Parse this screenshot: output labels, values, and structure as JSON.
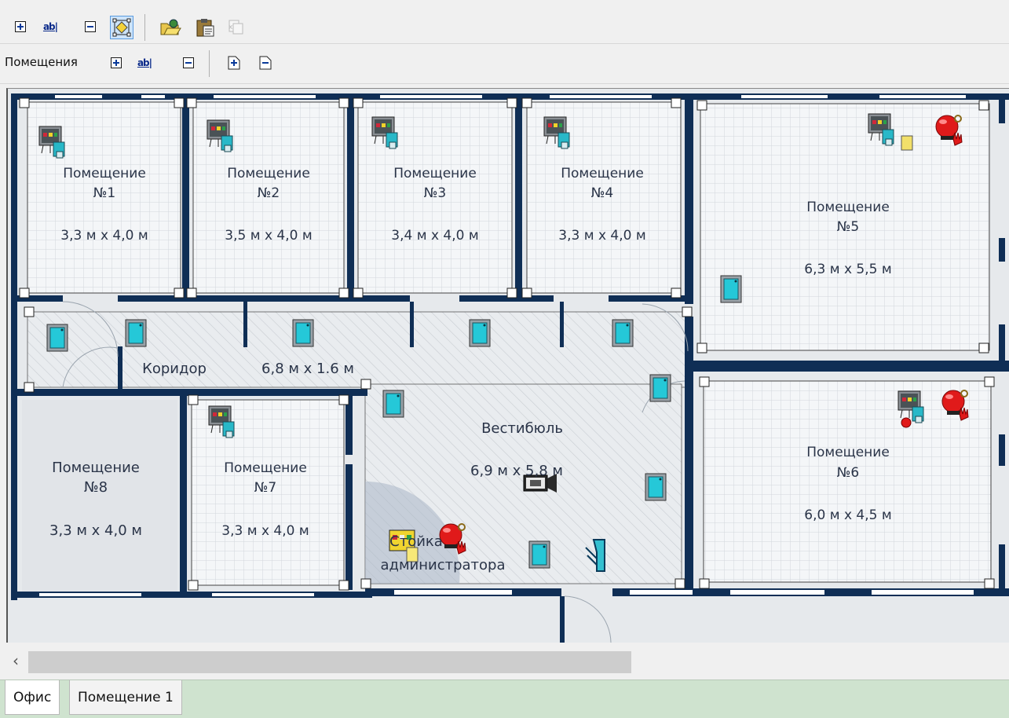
{
  "toolbar1": {
    "buttons": [
      {
        "name": "add-icon"
      },
      {
        "name": "rename-icon",
        "label": "ab|"
      },
      {
        "name": "remove-icon"
      },
      {
        "name": "select-room-icon"
      },
      {
        "name": "open-folder-icon"
      },
      {
        "name": "paste-icon"
      },
      {
        "name": "disabled-copy-icon"
      }
    ]
  },
  "toolbar2": {
    "label": "Помещения",
    "rename_label": "ab|"
  },
  "rooms": [
    {
      "name": "Помещение №1",
      "line1": "Помещение",
      "line2": "№1",
      "size": "3,3 м х 4,0 м"
    },
    {
      "name": "Помещение №2",
      "line1": "Помещение",
      "line2": "№2",
      "size": "3,5 м х 4,0 м"
    },
    {
      "name": "Помещение №3",
      "line1": "Помещение",
      "line2": "№3",
      "size": "3,4 м х 4,0 м"
    },
    {
      "name": "Помещение №4",
      "line1": "Помещение",
      "line2": "№4",
      "size": "3,3 м х 4,0 м"
    },
    {
      "name": "Помещение №5",
      "line1": "Помещение",
      "line2": "№5",
      "size": "6,3 м х 5,5 м"
    },
    {
      "name": "Помещение №6",
      "line1": "Помещение",
      "line2": "№6",
      "size": "6,0 м х 4,5 м"
    },
    {
      "name": "Помещение №7",
      "line1": "Помещение",
      "line2": "№7",
      "size": "3,3 м х 4,0 м"
    },
    {
      "name": "Помещение №8",
      "line1": "Помещение",
      "line2": "№8",
      "size": "3,3 м х 4,0 м"
    }
  ],
  "corridor": {
    "name": "Коридор",
    "size": "6,8 м х 1.6 м"
  },
  "lobby": {
    "name": "Вестибюль",
    "size": "6,9 м х 5,8 м"
  },
  "reception": {
    "line1": "Стойка",
    "line2": "администратора"
  },
  "tabs": [
    {
      "label": "Офис"
    },
    {
      "label": "Помещение 1"
    }
  ],
  "colors": {
    "wall": "#0f2e55",
    "room_fill": "#f4f6f8",
    "grid": "#d6dbe0",
    "handle": "#ffffff",
    "background": "#e6e9ec"
  }
}
